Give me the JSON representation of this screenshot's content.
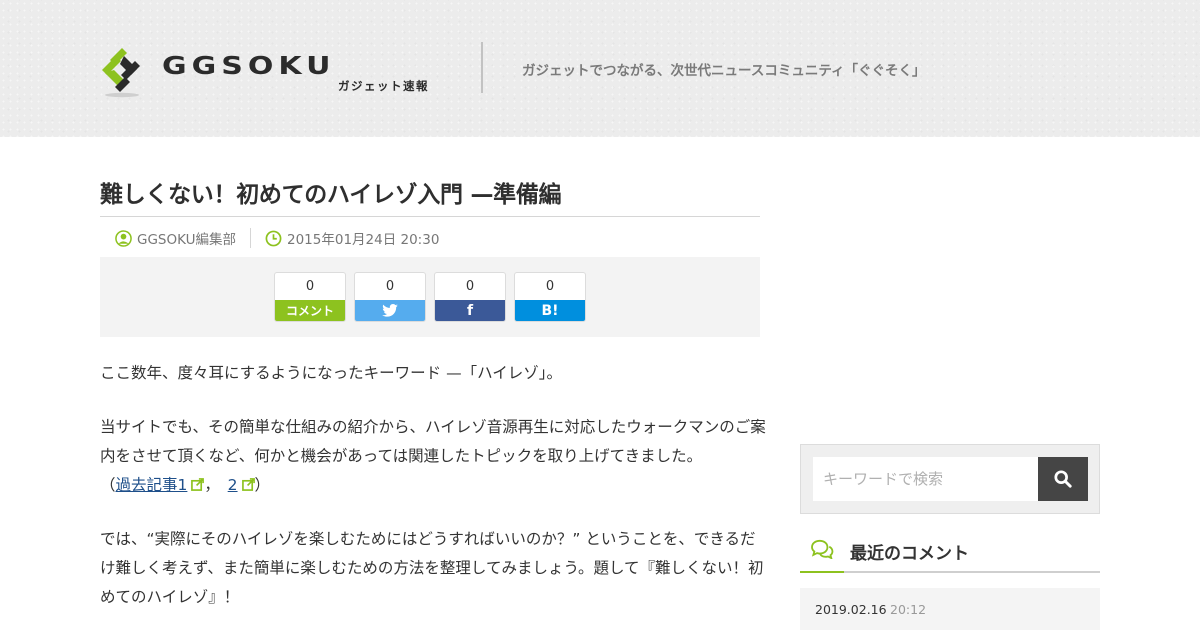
{
  "header": {
    "logo_word": "GGSOKU",
    "logo_sub": "ガジェット速報",
    "tagline": "ガジェットでつながる、次世代ニュースコミュニティ「ぐぐそく」"
  },
  "article": {
    "title": "難しくない！初めてのハイレゾ入門 —準備編",
    "author": "GGSOKU編集部",
    "datetime": "2015年01月24日 20:30",
    "share": [
      {
        "count": "0",
        "label": "コメント",
        "icon": "comment-label",
        "color": "#8dc21f"
      },
      {
        "count": "0",
        "label": "",
        "icon": "twitter-icon",
        "color": "#55acee"
      },
      {
        "count": "0",
        "label": "f",
        "icon": "facebook-icon",
        "color": "#3b5998"
      },
      {
        "count": "0",
        "label": "B!",
        "icon": "hatena-bookmark-icon",
        "color": "#008fde"
      }
    ],
    "p1": "ここ数年、度々耳にするようになったキーワード —「ハイレゾ」。",
    "p2_text": "当サイトでも、その簡単な仕組みの紹介から、ハイレゾ音源再生に対応したウォークマンのご案内をさせて頂くなど、何かと機会があっては関連したトピックを取り上げてきました。",
    "p2_open": "（",
    "p2_link1": "過去記事1",
    "p2_comma": "，",
    "p2_link2": "2",
    "p2_close": "）",
    "p3": "では、“実際にそのハイレゾを楽しむためにはどうすればいいのか？” ということを、できるだけ難しく考えず、また簡単に楽しむための方法を整理してみましょう。題して『難しくない！初めてのハイレゾ』！"
  },
  "sidebar": {
    "search_placeholder": "キーワードで検索",
    "recent_comments_title": "最近のコメント",
    "comments": [
      {
        "date": "2019.02.16",
        "time": "20:12"
      }
    ]
  },
  "colors": {
    "brand_green": "#8dc21f",
    "header_bg": "#ececec",
    "link": "#1e4f8a"
  }
}
